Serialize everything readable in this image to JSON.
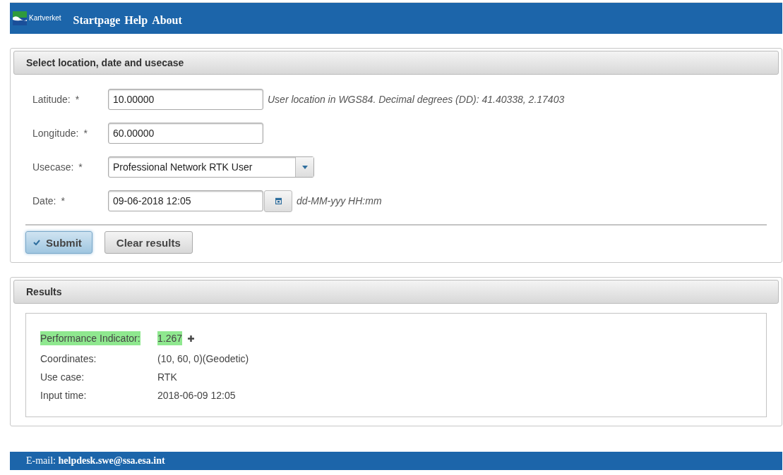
{
  "header": {
    "logo_text": "Kartverket",
    "nav": [
      {
        "label": "Startpage"
      },
      {
        "label": "Help"
      },
      {
        "label": "About"
      }
    ]
  },
  "form_panel": {
    "title": "Select location, date and usecase",
    "fields": [
      {
        "kind": "text",
        "label": "Latitude:",
        "required_mark": "*",
        "value": "10.00000",
        "hint": "User location in WGS84. Decimal degrees (DD): 41.40338, 2.17403"
      },
      {
        "kind": "text",
        "label": "Longitude:",
        "required_mark": "*",
        "value": "60.00000"
      },
      {
        "kind": "select",
        "label": "Usecase:",
        "required_mark": "*",
        "value": "Professional Network RTK User"
      },
      {
        "kind": "date",
        "label": "Date:",
        "required_mark": "*",
        "value": "09-06-2018 12:05",
        "hint": "dd-MM-yyy HH:mm"
      }
    ],
    "buttons": [
      {
        "label": "Submit",
        "kind": "primary"
      },
      {
        "label": "Clear results",
        "kind": "plain"
      }
    ]
  },
  "results_panel": {
    "title": "Results",
    "rows": [
      {
        "label": "Performance Indicator:",
        "value": "1.267",
        "highlighted": true,
        "expandable": true
      },
      {
        "label": "Coordinates:",
        "value": "(10, 60, 0)(Geodetic)",
        "highlighted": false,
        "expandable": false
      },
      {
        "label": "Use case:",
        "value": "RTK",
        "highlighted": false,
        "expandable": false
      },
      {
        "label": "Input time:",
        "value": "2018-06-09 12:05",
        "highlighted": false,
        "expandable": false
      }
    ]
  },
  "footer": {
    "text": "E-mail: **helpdesk.swe@ssa.esa.int**"
  }
}
